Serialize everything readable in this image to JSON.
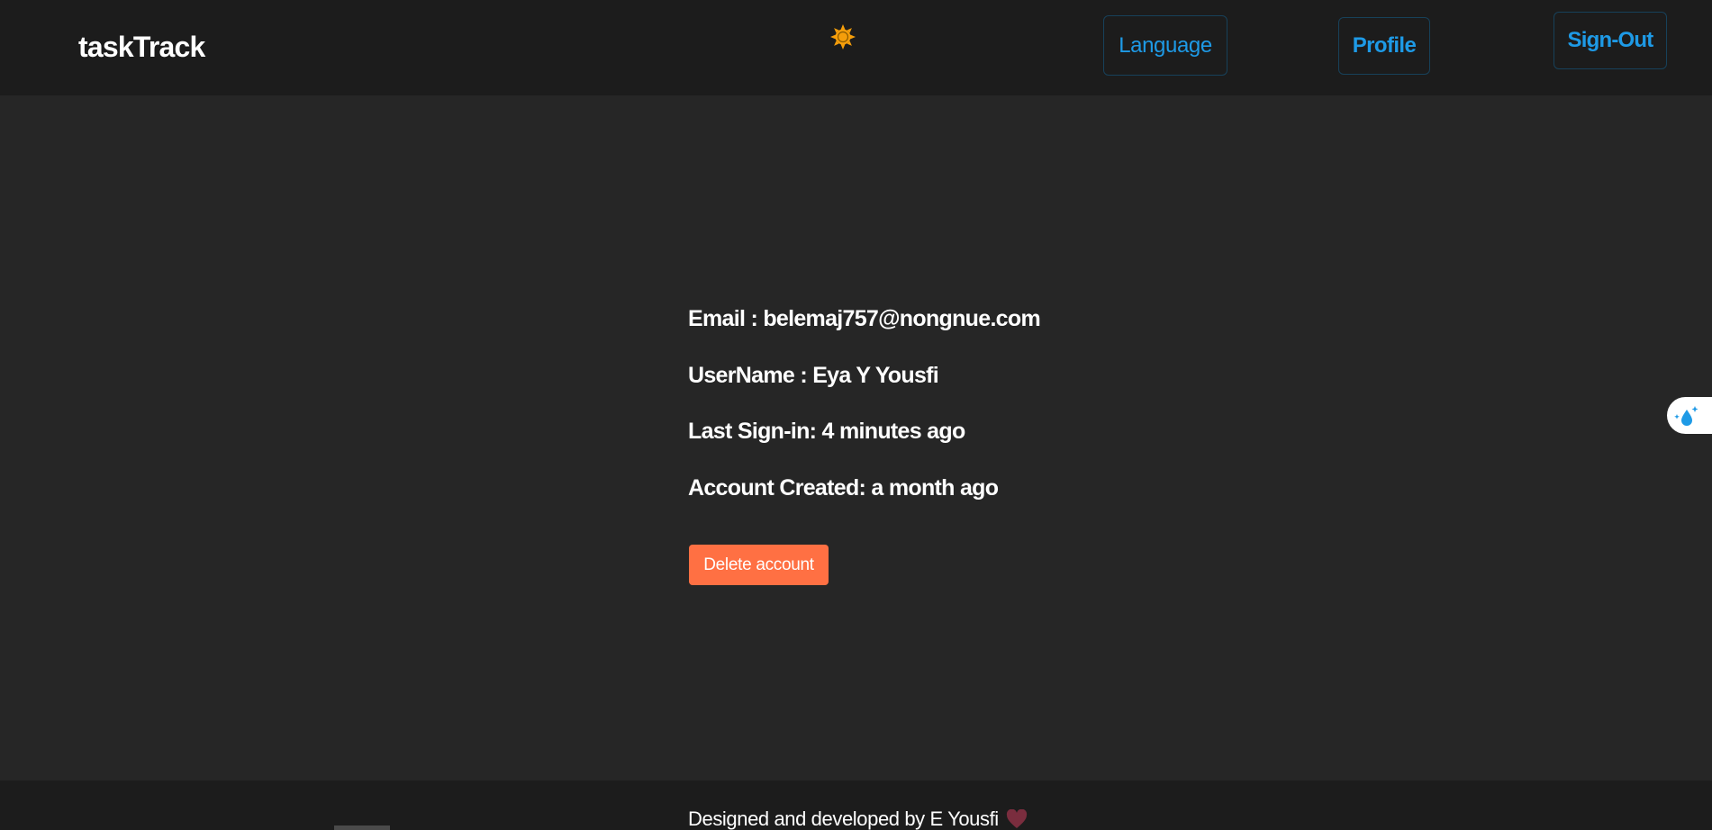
{
  "header": {
    "brand": "taskTrack",
    "theme_icon": "sun-icon",
    "nav": {
      "language_label": "Language",
      "profile_label": "Profile",
      "signout_label": "Sign-Out"
    }
  },
  "profile": {
    "email": "Email : belemaj757@nongnue.com",
    "username": "UserName : Eya Y Yousfi",
    "last_signin": "Last Sign-in: 4 minutes ago",
    "account_created": "Account Created: a month ago",
    "delete_label": "Delete account"
  },
  "side_widget": {
    "icon": "water-drop-sparkle-icon"
  },
  "footer": {
    "text": "Designed and developed by E Yousfi",
    "icon": "heart-icon"
  },
  "colors": {
    "page_bg": "#262626",
    "header_bg": "#1c1c1c",
    "accent_blue": "#1e9ae6",
    "delete_orange": "#ff7043",
    "sun_orange": "#f59e0b",
    "heart": "#7a2d3e"
  }
}
